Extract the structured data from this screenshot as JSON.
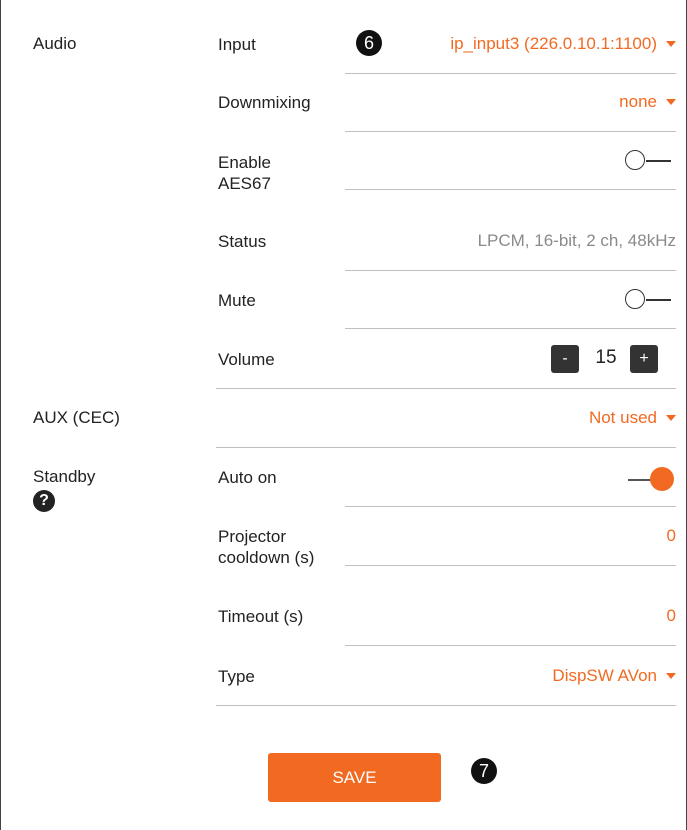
{
  "audio": {
    "section_label": "Audio",
    "input": {
      "label": "Input",
      "value": "ip_input3 (226.0.10.1:1100)",
      "badge": "6"
    },
    "downmixing": {
      "label": "Downmixing",
      "value": "none"
    },
    "enable_aes67": {
      "label_line1": "Enable",
      "label_line2": "AES67",
      "enabled": false
    },
    "status": {
      "label": "Status",
      "value": "LPCM, 16-bit, 2 ch, 48kHz"
    },
    "mute": {
      "label": "Mute",
      "enabled": false
    },
    "volume": {
      "label": "Volume",
      "value": "15",
      "minus": "-",
      "plus": "+"
    }
  },
  "aux": {
    "section_label": "AUX (CEC)",
    "value": "Not used"
  },
  "standby": {
    "section_label": "Standby",
    "help_icon": "?",
    "auto_on": {
      "label": "Auto on",
      "enabled": true
    },
    "projector_cooldown": {
      "label_line1": "Projector",
      "label_line2": "cooldown (s)",
      "value": "0"
    },
    "timeout": {
      "label": "Timeout (s)",
      "value": "0"
    },
    "type": {
      "label": "Type",
      "value": "DispSW AVon"
    }
  },
  "actions": {
    "save_label": "SAVE",
    "save_badge": "7"
  },
  "colors": {
    "accent": "#f26a21",
    "muted_text": "#8a8a8a",
    "separator": "#bfbfbf"
  }
}
